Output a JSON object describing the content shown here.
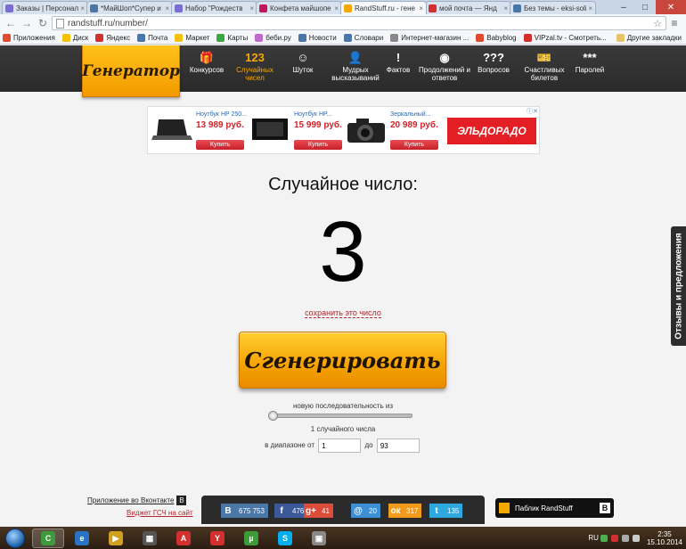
{
  "browser": {
    "tabs": [
      {
        "title": "Заказы | Персонал",
        "icon_color": "#7a6fd0"
      },
      {
        "title": "*МайШоп*Супер и",
        "icon_color": "#4a76a8"
      },
      {
        "title": "Набор \"Рождеств",
        "icon_color": "#7a6fd0"
      },
      {
        "title": "Конфета майшопе",
        "icon_color": "#c2185b"
      },
      {
        "title": "RandStuff.ru - гене",
        "icon_color": "#f5a800",
        "active": true
      },
      {
        "title": "мой почта — Янд",
        "icon_color": "#d32f2f"
      },
      {
        "title": "Без темы - eksi-soli",
        "icon_color": "#4a76a8"
      }
    ],
    "url": "randstuff.ru/number/",
    "bookmarks": [
      {
        "label": "Приложения",
        "color": "#e04a2f"
      },
      {
        "label": "Диск",
        "color": "#f2c200"
      },
      {
        "label": "Яндекс",
        "color": "#d32f2f"
      },
      {
        "label": "Почта",
        "color": "#4a76a8"
      },
      {
        "label": "Маркет",
        "color": "#f2c200"
      },
      {
        "label": "Карты",
        "color": "#39a845"
      },
      {
        "label": "беби.ру",
        "color": "#c06ad0"
      },
      {
        "label": "Новости",
        "color": "#4a76a8"
      },
      {
        "label": "Словари",
        "color": "#4a76a8"
      },
      {
        "label": "Интернет-магазин ...",
        "color": "#888888"
      },
      {
        "label": "Babyblog",
        "color": "#e04a2f"
      },
      {
        "label": "VIPzal.tv - Смотреть...",
        "color": "#d32f2f"
      }
    ],
    "other_bookmarks": "Другие закладки"
  },
  "site": {
    "logo": "Генератор",
    "nav": [
      {
        "icon": "🎁",
        "label": "Конкурсов",
        "icon_name": "gift-icon"
      },
      {
        "icon": "123",
        "label": "Случайных чисел",
        "icon_name": "numbers-icon",
        "active": true
      },
      {
        "icon": "☺",
        "label": "Шуток",
        "icon_name": "smile-icon"
      },
      {
        "icon": "👤",
        "label": "Мудрых высказываний",
        "icon_name": "wise-man-icon"
      },
      {
        "icon": "!",
        "label": "Фактов",
        "icon_name": "exclamation-icon"
      },
      {
        "icon": "◉",
        "label": "Продолжений и ответов",
        "icon_name": "magic-ball-icon"
      },
      {
        "icon": "???",
        "label": "Вопросов",
        "icon_name": "question-icon"
      },
      {
        "icon": "🎫",
        "label": "Счастливых билетов",
        "icon_name": "ticket-icon"
      },
      {
        "icon": "***",
        "label": "Паролей",
        "icon_name": "password-icon"
      }
    ]
  },
  "ad": {
    "products": [
      {
        "name": "Ноутбук HP 250...",
        "price": "13 989 руб.",
        "buy": "Купить"
      },
      {
        "name": "Ноутбук HP...",
        "price": "15 999 руб.",
        "buy": "Купить"
      },
      {
        "name": "Зеркальный...",
        "price": "20 989 руб.",
        "buy": "Купить"
      }
    ],
    "brand": "ЭЛЬДОРАДО"
  },
  "main": {
    "title": "Случайное число:",
    "number": "3",
    "save_link": "сохранить это число",
    "generate_button": "Сгенерировать",
    "sequence_label": "новую последовательность из",
    "count_label": "1 случайного числа",
    "range_from_label": "в диапазоне от",
    "range_from": "1",
    "range_to_label": "до",
    "range_to": "93"
  },
  "feedback": "Отзывы и предложения",
  "footer": {
    "vk_app": "Приложение во Вконтакте",
    "vk_badge": "В",
    "gsm_widget": "Виджет ГСЧ на сайт",
    "shares": [
      {
        "icon": "В",
        "count": "675 753",
        "color": "#4a76a8"
      },
      {
        "icon": "f",
        "count": "476",
        "color": "#3b5998"
      },
      {
        "icon": "g+",
        "count": "41",
        "color": "#dd4b39"
      },
      {
        "icon": "@",
        "count": "20",
        "color": "#3d8fd6"
      },
      {
        "icon": "ок",
        "count": "317",
        "color": "#f29a1a"
      },
      {
        "icon": "t",
        "count": "135",
        "color": "#2fa8e0"
      }
    ],
    "public_label": "Паблик RandStuff",
    "public_vk": "В"
  },
  "taskbar": {
    "apps": [
      {
        "label": "C",
        "color": "#3d9b3b",
        "active": true
      },
      {
        "label": "e",
        "color": "#2a73c4"
      },
      {
        "label": "▶",
        "color": "#d0a020"
      },
      {
        "label": "▦",
        "color": "#555555"
      },
      {
        "label": "A",
        "color": "#d32f2f"
      },
      {
        "label": "Y",
        "color": "#d32f2f"
      },
      {
        "label": "µ",
        "color": "#3d9b3b"
      },
      {
        "label": "S",
        "color": "#00aff0"
      },
      {
        "label": "▣",
        "color": "#888888"
      }
    ],
    "lang": "RU",
    "time": "2:35",
    "date": "15.10.2014"
  }
}
